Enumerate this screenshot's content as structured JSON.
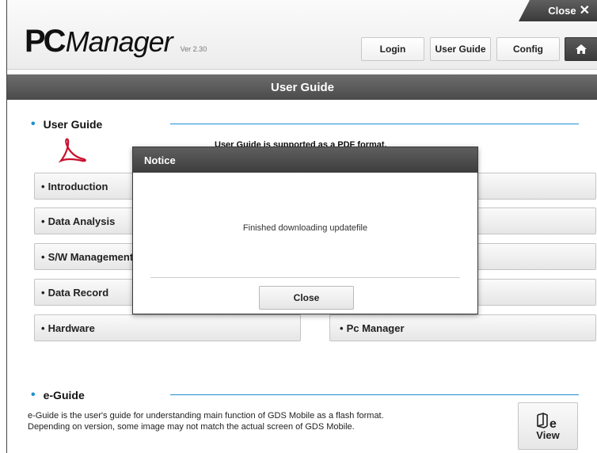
{
  "header": {
    "close_label": "Close",
    "logo_pc": "PC",
    "logo_manager": "Manager",
    "version": "Ver 2.30",
    "login_label": "Login",
    "user_guide_label": "User Guide",
    "config_label": "Config",
    "home_icon": "home-icon"
  },
  "page_title": "User Guide",
  "user_guide": {
    "title": "User Guide",
    "pdf_text": "User Guide is supported as a PDF format.",
    "buttons": [
      {
        "label": "Introduction"
      },
      {
        "label": "Data Analysis"
      },
      {
        "label": "S/W Management"
      },
      {
        "label": "Data Record"
      },
      {
        "label": "Hardware"
      },
      {
        "label": "Pc Manager"
      }
    ]
  },
  "e_guide": {
    "title": "e-Guide",
    "line1": "e-Guide is the user's guide for understanding main function of GDS Mobile as a flash format.",
    "line2": "Depending on version, some image may not match the actual screen of GDS Mobile.",
    "view_label": "View"
  },
  "notice": {
    "title": "Notice",
    "message": "Finished downloading updatefile",
    "close_label": "Close"
  },
  "colors": {
    "accent": "#1f8fd0",
    "dark_bar": "#4a4a4a",
    "pdf_red": "#c8102e"
  }
}
